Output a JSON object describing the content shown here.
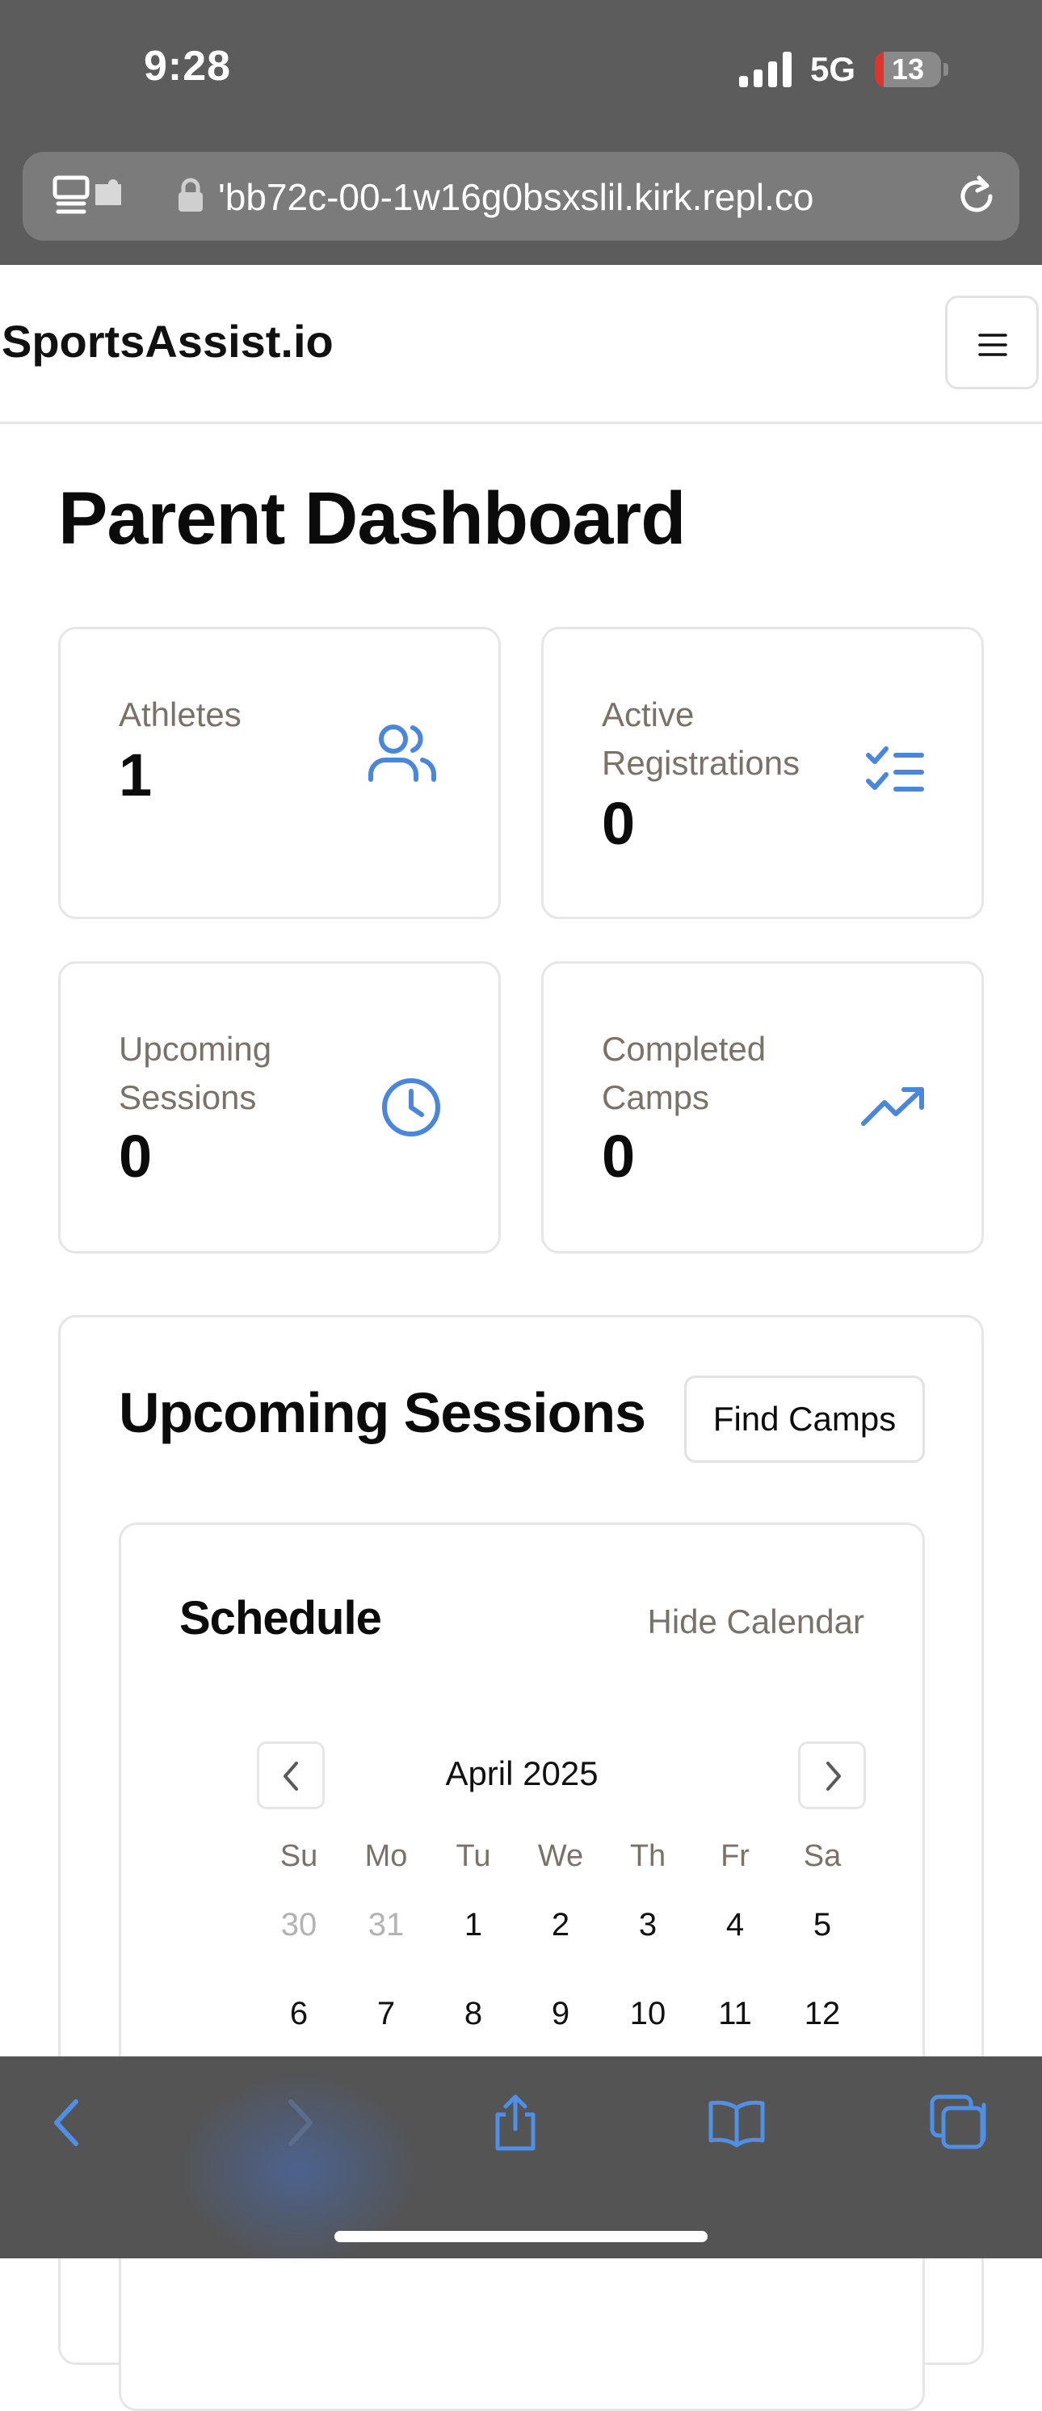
{
  "status_bar": {
    "time": "9:28",
    "network": "5G",
    "battery": "13",
    "battery_color": "#e0332c"
  },
  "browser": {
    "url": "'bb72c-00-1w16g0bsxslil.kirk.repl.co",
    "icons": [
      "page-settings-icon",
      "lock-icon",
      "reload-icon"
    ]
  },
  "header": {
    "brand": "SportsAssist.io",
    "menu_icon": "hamburger-menu-icon"
  },
  "dashboard": {
    "title": "Parent Dashboard",
    "accent_color": "#4a86d9",
    "stats": [
      {
        "label": "Athletes",
        "value": "1",
        "icon": "users-icon"
      },
      {
        "label": "Active Registrations",
        "value": "0",
        "icon": "checklist-icon"
      },
      {
        "label": "Upcoming Sessions",
        "value": "0",
        "icon": "clock-icon"
      },
      {
        "label": "Completed Camps",
        "value": "0",
        "icon": "trending-up-icon"
      }
    ]
  },
  "sessions": {
    "title": "Upcoming Sessions",
    "find_camps_label": "Find Camps",
    "schedule": {
      "title": "Schedule",
      "toggle_label": "Hide Calendar",
      "month": "April 2025",
      "weekdays": [
        "Su",
        "Mo",
        "Tu",
        "We",
        "Th",
        "Fr",
        "Sa"
      ],
      "weeks": [
        [
          "30",
          "31",
          "1",
          "2",
          "3",
          "4",
          "5"
        ],
        [
          "6",
          "7",
          "8",
          "9",
          "10",
          "11",
          "12"
        ]
      ],
      "outside_month_days": [
        "30",
        "31"
      ]
    }
  },
  "toolbar": {
    "icons": [
      "back-icon",
      "forward-icon",
      "share-icon",
      "bookmarks-icon",
      "tabs-icon"
    ]
  }
}
